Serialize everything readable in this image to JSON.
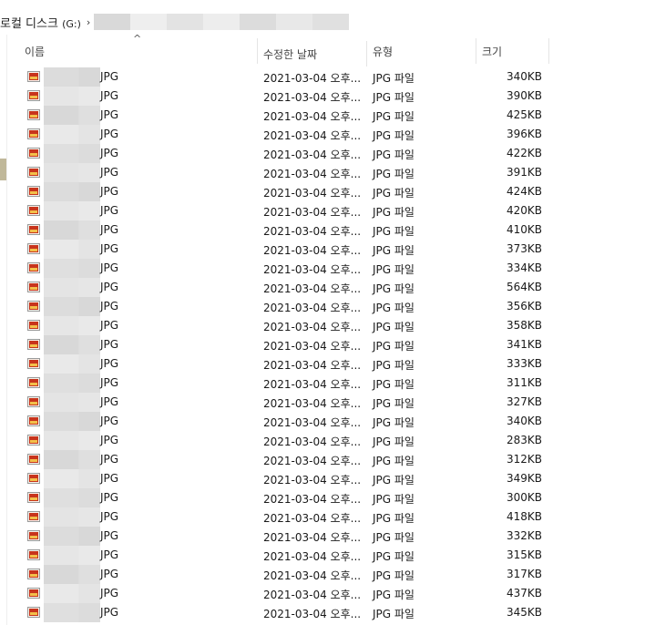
{
  "breadcrumb": {
    "drive_label": "로컬 디스크",
    "drive_letter": "(G:)",
    "chevron": "›"
  },
  "columns": {
    "name": "이름",
    "date": "수정한 날짜",
    "type": "유형",
    "size": "크기",
    "sort_indicator": "^"
  },
  "files": [
    {
      "ext": "JPG",
      "date": "2021-03-04 오후...",
      "type": "JPG 파일",
      "size": "340KB"
    },
    {
      "ext": "JPG",
      "date": "2021-03-04 오후...",
      "type": "JPG 파일",
      "size": "390KB"
    },
    {
      "ext": "JPG",
      "date": "2021-03-04 오후...",
      "type": "JPG 파일",
      "size": "425KB"
    },
    {
      "ext": "JPG",
      "date": "2021-03-04 오후...",
      "type": "JPG 파일",
      "size": "396KB"
    },
    {
      "ext": "JPG",
      "date": "2021-03-04 오후...",
      "type": "JPG 파일",
      "size": "422KB"
    },
    {
      "ext": "JPG",
      "date": "2021-03-04 오후...",
      "type": "JPG 파일",
      "size": "391KB"
    },
    {
      "ext": "JPG",
      "date": "2021-03-04 오후...",
      "type": "JPG 파일",
      "size": "424KB"
    },
    {
      "ext": "JPG",
      "date": "2021-03-04 오후...",
      "type": "JPG 파일",
      "size": "420KB"
    },
    {
      "ext": "JPG",
      "date": "2021-03-04 오후...",
      "type": "JPG 파일",
      "size": "410KB"
    },
    {
      "ext": "JPG",
      "date": "2021-03-04 오후...",
      "type": "JPG 파일",
      "size": "373KB"
    },
    {
      "ext": "JPG",
      "date": "2021-03-04 오후...",
      "type": "JPG 파일",
      "size": "334KB"
    },
    {
      "ext": "JPG",
      "date": "2021-03-04 오후...",
      "type": "JPG 파일",
      "size": "564KB"
    },
    {
      "ext": "JPG",
      "date": "2021-03-04 오후...",
      "type": "JPG 파일",
      "size": "356KB"
    },
    {
      "ext": "JPG",
      "date": "2021-03-04 오후...",
      "type": "JPG 파일",
      "size": "358KB"
    },
    {
      "ext": "JPG",
      "date": "2021-03-04 오후...",
      "type": "JPG 파일",
      "size": "341KB"
    },
    {
      "ext": "JPG",
      "date": "2021-03-04 오후...",
      "type": "JPG 파일",
      "size": "333KB"
    },
    {
      "ext": "JPG",
      "date": "2021-03-04 오후...",
      "type": "JPG 파일",
      "size": "311KB"
    },
    {
      "ext": "JPG",
      "date": "2021-03-04 오후...",
      "type": "JPG 파일",
      "size": "327KB"
    },
    {
      "ext": "JPG",
      "date": "2021-03-04 오후...",
      "type": "JPG 파일",
      "size": "340KB"
    },
    {
      "ext": "JPG",
      "date": "2021-03-04 오후...",
      "type": "JPG 파일",
      "size": "283KB"
    },
    {
      "ext": "JPG",
      "date": "2021-03-04 오후...",
      "type": "JPG 파일",
      "size": "312KB"
    },
    {
      "ext": "JPG",
      "date": "2021-03-04 오후...",
      "type": "JPG 파일",
      "size": "349KB"
    },
    {
      "ext": "JPG",
      "date": "2021-03-04 오후...",
      "type": "JPG 파일",
      "size": "300KB"
    },
    {
      "ext": "JPG",
      "date": "2021-03-04 오후...",
      "type": "JPG 파일",
      "size": "418KB"
    },
    {
      "ext": "JPG",
      "date": "2021-03-04 오후...",
      "type": "JPG 파일",
      "size": "332KB"
    },
    {
      "ext": "JPG",
      "date": "2021-03-04 오후...",
      "type": "JPG 파일",
      "size": "315KB"
    },
    {
      "ext": "JPG",
      "date": "2021-03-04 오후...",
      "type": "JPG 파일",
      "size": "317KB"
    },
    {
      "ext": "JPG",
      "date": "2021-03-04 오후...",
      "type": "JPG 파일",
      "size": "437KB"
    },
    {
      "ext": "JPG",
      "date": "2021-03-04 오후...",
      "type": "JPG 파일",
      "size": "345KB"
    }
  ],
  "icons": {
    "file": "jpg-file-icon",
    "chevron": "chevron-right-icon"
  },
  "colors": {
    "redaction_light": "#e9e9e9",
    "redaction_dark": "#d6d6d6"
  }
}
